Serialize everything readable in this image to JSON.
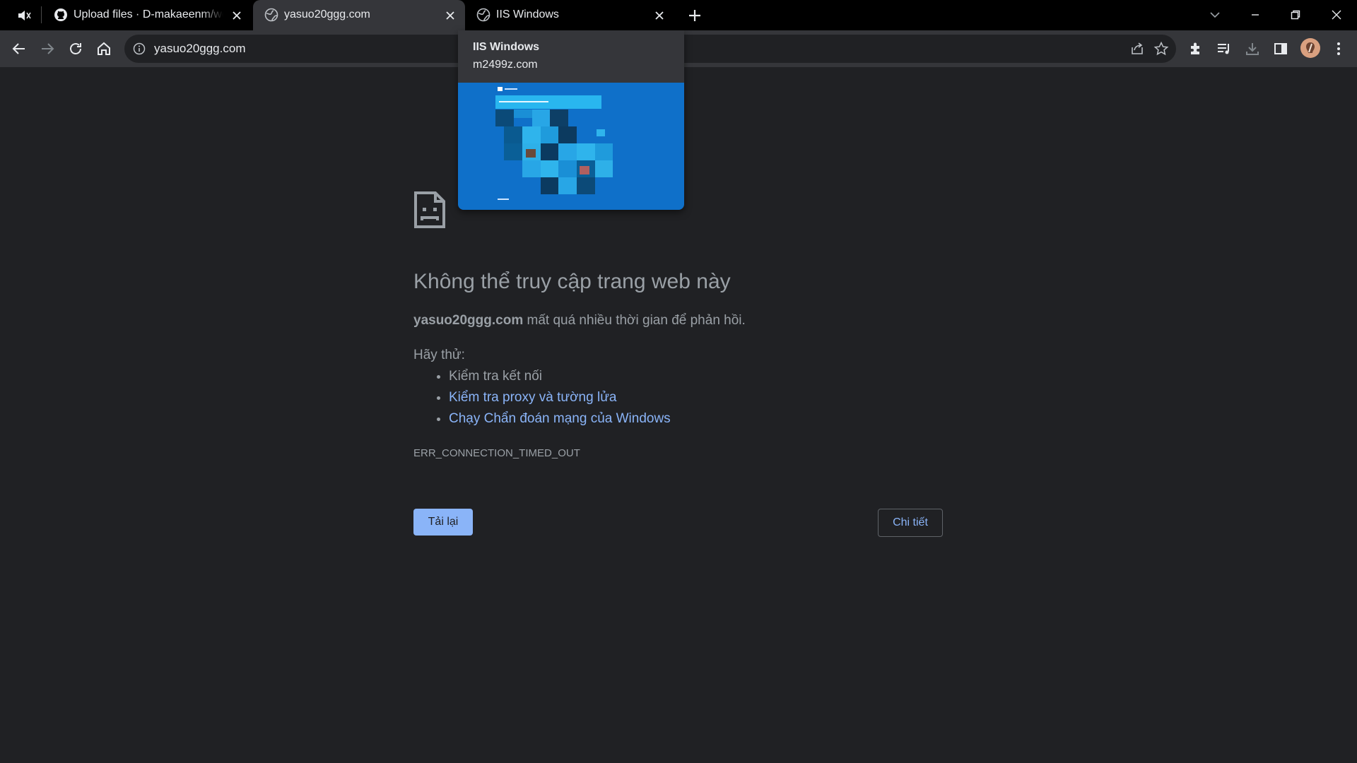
{
  "tabs": [
    {
      "title": "Upload files · D-makaeenm/webl",
      "icon": "github-icon",
      "active": false
    },
    {
      "title": "yasuo20ggg.com",
      "icon": "globe-icon",
      "active": true
    },
    {
      "title": "IIS Windows",
      "icon": "globe-icon",
      "active": false
    }
  ],
  "toolbar": {
    "url": "yasuo20ggg.com"
  },
  "hover_card": {
    "title": "IIS Windows",
    "domain": "m2499z.com"
  },
  "error_page": {
    "heading": "Không thể truy cập trang web này",
    "host": "yasuo20ggg.com",
    "description": " mất quá nhiều thời gian để phản hồi.",
    "try_label": "Hãy thử:",
    "suggestions": [
      {
        "text": "Kiểm tra kết nối",
        "link": false
      },
      {
        "text": "Kiểm tra proxy và tường lửa",
        "link": true
      },
      {
        "text": "Chạy Chẩn đoán mạng của Windows",
        "link": true
      }
    ],
    "error_code": "ERR_CONNECTION_TIMED_OUT",
    "reload_label": "Tải lại",
    "details_label": "Chi tiết"
  },
  "colors": {
    "page_bg": "#202124",
    "toolbar_bg": "#35363a",
    "tabstrip_bg": "#000000",
    "link": "#8ab4f8",
    "text_muted": "#9aa0a6"
  }
}
